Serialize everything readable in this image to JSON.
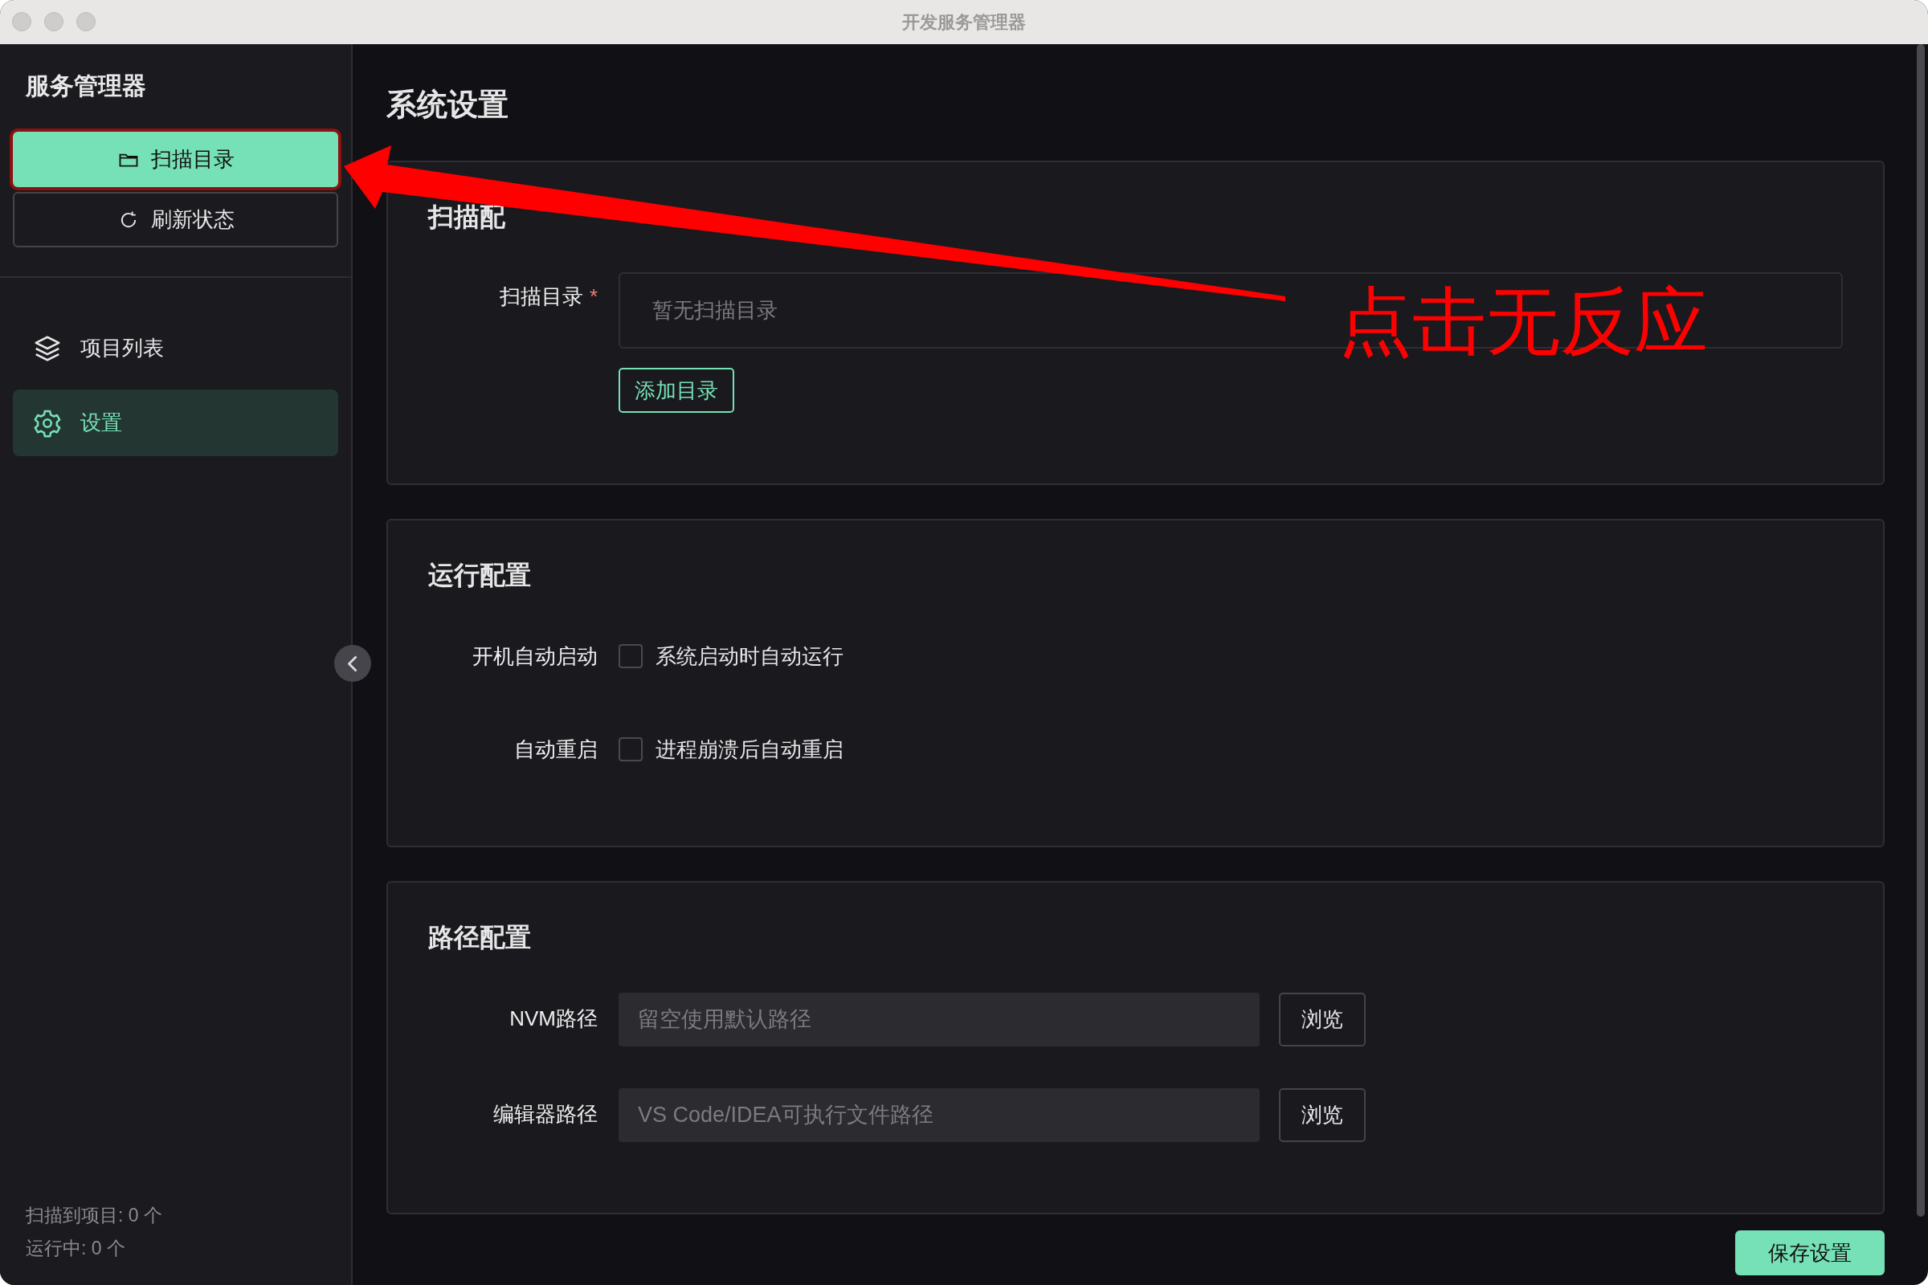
{
  "window": {
    "title": "开发服务管理器"
  },
  "sidebar": {
    "title": "服务管理器",
    "actions": [
      {
        "label": "扫描目录",
        "kind": "scan",
        "highlighted": true
      },
      {
        "label": "刷新状态",
        "kind": "refresh",
        "highlighted": false
      }
    ],
    "nav": [
      {
        "label": "项目列表",
        "kind": "projects",
        "selected": false
      },
      {
        "label": "设置",
        "kind": "settings",
        "selected": true
      }
    ],
    "stats": [
      "扫描到项目: 0 个",
      "运行中: 0 个"
    ]
  },
  "main": {
    "title": "系统设置",
    "sections": [
      {
        "title": "扫描配",
        "fields": [
          {
            "kind": "list",
            "label": "扫描目录",
            "required_mark": "*",
            "placeholder": "暂无扫描目录",
            "button": "添加目录"
          }
        ]
      },
      {
        "title": "运行配置",
        "fields": [
          {
            "kind": "checkbox",
            "label": "开机自动启动",
            "option": "系统启动时自动运行",
            "checked": false
          },
          {
            "kind": "checkbox",
            "label": "自动重启",
            "option": "进程崩溃后自动重启",
            "checked": false
          }
        ]
      },
      {
        "title": "路径配置",
        "fields": [
          {
            "kind": "path",
            "label": "NVM路径",
            "placeholder": "留空使用默认路径",
            "button": "浏览"
          },
          {
            "kind": "path",
            "label": "编辑器路径",
            "placeholder": "VS Code/IDEA可执行文件路径",
            "button": "浏览"
          }
        ]
      }
    ],
    "save_button": "保存设置"
  },
  "annotation": {
    "text": "点击无反应"
  }
}
